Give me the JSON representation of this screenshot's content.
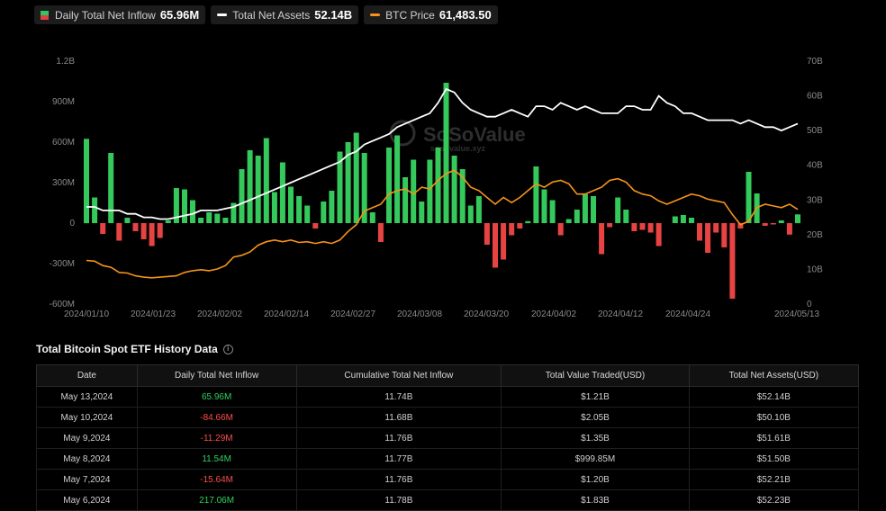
{
  "legend": [
    {
      "label": "Daily Total Net Inflow",
      "value": "65.96M",
      "swatch": "bar"
    },
    {
      "label": "Total Net Assets",
      "value": "52.14B",
      "swatch": "line",
      "color": "#ffffff"
    },
    {
      "label": "BTC Price",
      "value": "61,483.50",
      "swatch": "line",
      "color": "#f7931a"
    }
  ],
  "watermark": {
    "brand": "SoSoValue",
    "domain": "sosovalue.xyz"
  },
  "chart_data": {
    "type": "bar",
    "left_axis_ticks": [
      "1.2B",
      "900M",
      "600M",
      "300M",
      "0",
      "-300M",
      "-600M"
    ],
    "left_axis_range": [
      -600,
      1200
    ],
    "right_axis_ticks": [
      "70B",
      "60B",
      "50B",
      "40B",
      "30B",
      "20B",
      "10B",
      "0"
    ],
    "right_axis_range": [
      0,
      70
    ],
    "x_ticks": [
      "2024/01/10",
      "2024/01/23",
      "2024/02/02",
      "2024/02/14",
      "2024/02/27",
      "2024/03/08",
      "2024/03/20",
      "2024/04/02",
      "2024/04/12",
      "2024/04/24",
      "2024/05/13"
    ],
    "colors": {
      "inflow_positive": "#35c95c",
      "inflow_negative": "#e84343",
      "net_assets": "#ffffff",
      "btc_price": "#f7931a"
    },
    "series": [
      {
        "key": "inflow",
        "unit": "M",
        "values": [
          625,
          190,
          -80,
          520,
          -130,
          40,
          -60,
          -120,
          -170,
          -110,
          20,
          260,
          250,
          170,
          40,
          80,
          70,
          40,
          150,
          400,
          540,
          500,
          630,
          230,
          450,
          270,
          200,
          130,
          -40,
          160,
          240,
          530,
          600,
          670,
          520,
          80,
          -140,
          560,
          650,
          340,
          470,
          160,
          470,
          560,
          1040,
          500,
          400,
          130,
          200,
          -160,
          -330,
          -270,
          -90,
          -40,
          15,
          420,
          250,
          170,
          -90,
          30,
          100,
          215,
          200,
          -230,
          -30,
          190,
          100,
          -60,
          -50,
          -70,
          -170,
          0,
          50,
          60,
          40,
          -130,
          -220,
          -70,
          -180,
          -560,
          -40,
          380,
          220,
          -20,
          -10,
          20,
          -85,
          65
        ]
      },
      {
        "key": "net_assets",
        "unit": "B",
        "values": [
          28,
          28,
          27,
          27,
          27,
          26,
          26,
          25,
          25,
          24.5,
          24.5,
          25,
          25.5,
          26,
          27,
          27,
          27,
          27.5,
          28,
          29,
          30,
          31,
          32,
          33,
          34,
          35,
          36,
          37,
          38,
          39,
          40,
          41,
          43,
          44,
          46,
          47,
          48,
          49,
          51,
          52,
          53,
          54,
          55,
          58,
          62,
          61,
          58,
          56,
          55,
          54,
          54,
          55,
          56,
          55,
          54,
          57,
          57,
          56,
          58,
          57,
          56,
          57,
          56,
          55,
          55,
          55,
          57,
          57,
          56,
          56,
          60,
          58,
          57,
          55,
          55,
          54,
          53,
          53,
          53,
          53,
          52,
          53,
          52,
          51,
          51,
          50,
          51,
          52
        ]
      },
      {
        "key": "btc_price",
        "values": [
          46500,
          46300,
          45000,
          44500,
          43000,
          42800,
          42000,
          41600,
          41400,
          41600,
          41800,
          42000,
          43000,
          43500,
          43800,
          43500,
          44000,
          45000,
          47500,
          48000,
          49000,
          51000,
          52000,
          52500,
          52000,
          52500,
          51800,
          52000,
          51500,
          52000,
          51500,
          52500,
          55000,
          57000,
          61000,
          62000,
          63000,
          66000,
          67000,
          67500,
          66000,
          68000,
          67500,
          70000,
          72000,
          73000,
          71000,
          68000,
          67000,
          65000,
          63000,
          65000,
          63500,
          65000,
          67000,
          69000,
          68000,
          69500,
          70000,
          69000,
          66000,
          66000,
          67000,
          68000,
          70000,
          70500,
          69500,
          67000,
          66000,
          65500,
          64000,
          63000,
          64000,
          65000,
          66000,
          65500,
          64500,
          64000,
          63500,
          60000,
          57000,
          58000,
          62000,
          63000,
          62500,
          62000,
          63000,
          61483.5
        ]
      }
    ]
  },
  "history": {
    "title": "Total Bitcoin Spot ETF History Data",
    "columns": [
      "Date",
      "Daily Total Net Inflow",
      "Cumulative Total Net Inflow",
      "Total Value Traded(USD)",
      "Total Net Assets(USD)"
    ],
    "rows": [
      {
        "date": "May 13,2024",
        "inflow": "65.96M",
        "sign": "pos",
        "cumulative": "11.74B",
        "traded": "$1.21B",
        "assets": "$52.14B"
      },
      {
        "date": "May 10,2024",
        "inflow": "-84.66M",
        "sign": "neg",
        "cumulative": "11.68B",
        "traded": "$2.05B",
        "assets": "$50.10B"
      },
      {
        "date": "May 9,2024",
        "inflow": "-11.29M",
        "sign": "neg",
        "cumulative": "11.76B",
        "traded": "$1.35B",
        "assets": "$51.61B"
      },
      {
        "date": "May 8,2024",
        "inflow": "11.54M",
        "sign": "pos",
        "cumulative": "11.77B",
        "traded": "$999.85M",
        "assets": "$51.50B"
      },
      {
        "date": "May 7,2024",
        "inflow": "-15.64M",
        "sign": "neg",
        "cumulative": "11.76B",
        "traded": "$1.20B",
        "assets": "$52.21B"
      },
      {
        "date": "May 6,2024",
        "inflow": "217.06M",
        "sign": "pos",
        "cumulative": "11.78B",
        "traded": "$1.83B",
        "assets": "$52.23B"
      }
    ]
  }
}
